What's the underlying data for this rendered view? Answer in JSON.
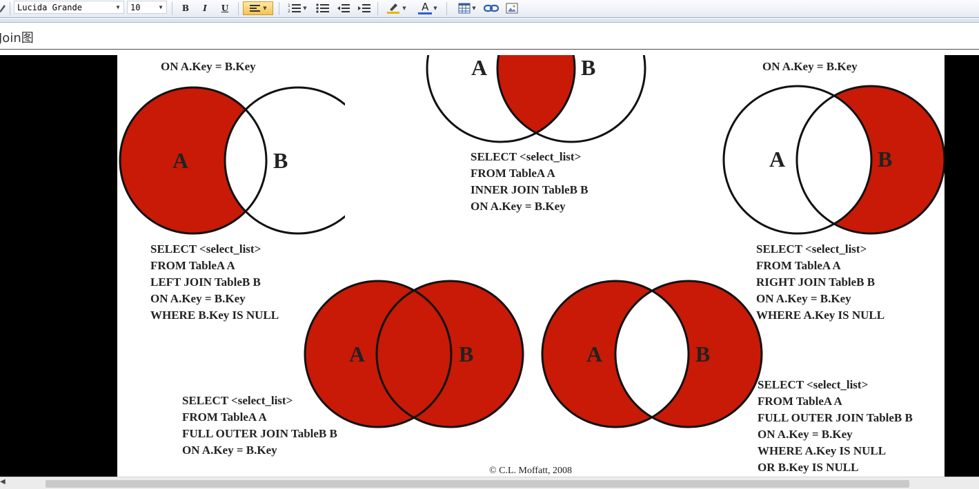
{
  "toolbar": {
    "font_family_value": "Lucida Grande",
    "font_size_value": "10",
    "bold_label": "B",
    "italic_label": "I",
    "underline_label": "U",
    "text_color_label": "A"
  },
  "editor": {
    "title": "Join图"
  },
  "diagrams": {
    "label_a": "A",
    "label_b": "B",
    "top_left_sql": [
      "ON A.Key = B.Key"
    ],
    "top_right_sql": [
      "ON A.Key = B.Key"
    ],
    "inner_sql": [
      "SELECT <select_list>",
      "FROM TableA A",
      "INNER JOIN TableB B",
      "ON A.Key = B.Key"
    ],
    "left_excl_sql": [
      "SELECT <select_list>",
      "FROM TableA A",
      "LEFT JOIN TableB B",
      "ON A.Key = B.Key",
      "WHERE B.Key IS NULL"
    ],
    "right_excl_sql": [
      "SELECT <select_list>",
      "FROM TableA A",
      "RIGHT JOIN TableB B",
      "ON A.Key = B.Key",
      "WHERE A.Key IS NULL"
    ],
    "full_sql": [
      "SELECT <select_list>",
      "FROM TableA A",
      "FULL OUTER JOIN TableB B",
      "ON A.Key = B.Key"
    ],
    "full_excl_sql": [
      "SELECT <select_list>",
      "FROM TableA A",
      "FULL OUTER JOIN TableB B",
      "ON A.Key = B.Key",
      "WHERE A.Key IS NULL",
      "OR B.Key IS NULL"
    ],
    "credit": "© C.L. Moffatt, 2008"
  },
  "colors": {
    "fill_red": "#c81a06",
    "outline": "#111111"
  },
  "icons": [
    "pen-icon",
    "numbered-list-icon",
    "bullet-list-icon",
    "outdent-icon",
    "indent-icon",
    "highlight-icon",
    "font-color-icon",
    "table-icon",
    "link-icon",
    "image-icon",
    "align-left-icon"
  ]
}
